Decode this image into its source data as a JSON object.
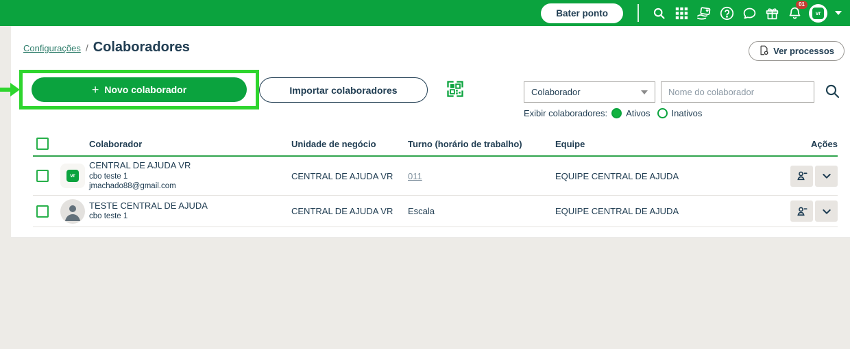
{
  "topbar": {
    "clock_button": "Bater ponto",
    "notification_badge": "01",
    "avatar_logo_text": "vr"
  },
  "breadcrumb": {
    "parent": "Configurações",
    "separator": "/",
    "current": "Colaboradores"
  },
  "header": {
    "processes_button": "Ver processos"
  },
  "toolbar": {
    "new_button_plus": "+",
    "new_button": "Novo colaborador",
    "import_button": "Importar colaboradores"
  },
  "filters": {
    "type_select_value": "Colaborador",
    "search_placeholder": "Nome do colaborador",
    "show_label": "Exibir colaboradores:",
    "options": [
      {
        "label": "Ativos",
        "selected": true
      },
      {
        "label": "Inativos",
        "selected": false
      }
    ]
  },
  "table": {
    "headers": [
      "Colaborador",
      "Unidade de negócio",
      "Turno (horário de trabalho)",
      "Equipe",
      "Ações"
    ],
    "rows": [
      {
        "avatar_logo_text": "vr",
        "name": "CENTRAL DE AJUDA VR",
        "role": "cbo teste 1",
        "email": "jmachado88@gmail.com",
        "unit": "CENTRAL DE AJUDA VR",
        "shift": "011",
        "team": "EQUIPE CENTRAL DE AJUDA"
      },
      {
        "name": "TESTE CENTRAL DE AJUDA",
        "role": "cbo teste 1",
        "unit": "CENTRAL DE AJUDA VR",
        "shift": "Escala",
        "team": "EQUIPE CENTRAL DE AJUDA"
      }
    ]
  },
  "colors": {
    "brand_green": "#0ba33e",
    "annotation_green": "#2ed52e",
    "dark_navy_text": "#203d52",
    "breadcrumb_link": "#2e7d6b",
    "shift_link": "#7c8e9c",
    "badge_red": "#c53b31",
    "header_underline": "#2fa44d",
    "action_button_bg": "#e8e5e1",
    "page_bg": "#edebe7"
  }
}
